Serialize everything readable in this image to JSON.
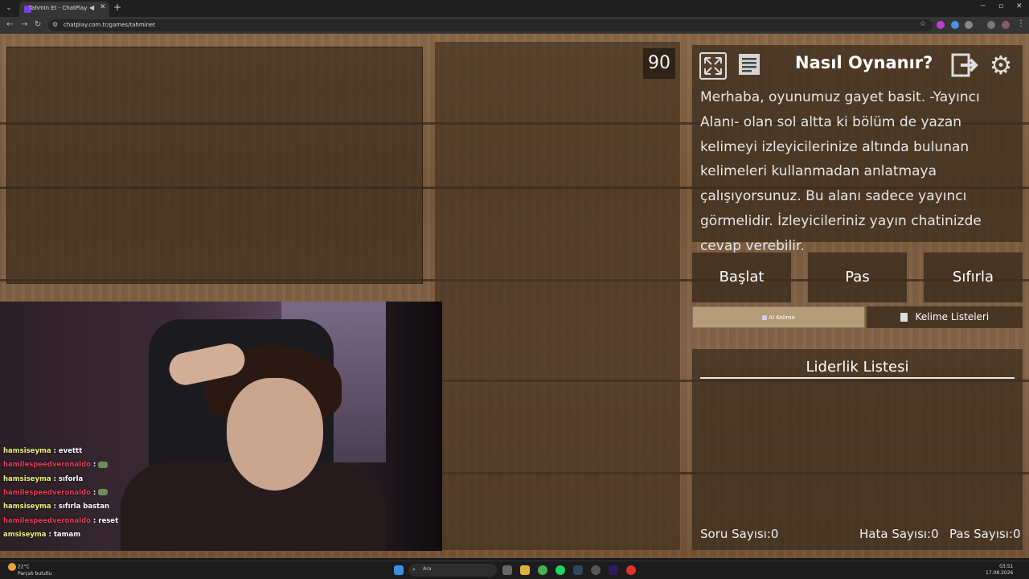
{
  "browser": {
    "tab_title": "Tahmin Et - ChatPlay",
    "url": "chatplay.com.tr/games/tahminet"
  },
  "game": {
    "timer": "90",
    "howto_title": "Nasıl Oynanır?",
    "howto_text": "Merhaba, oyunumuz gayet basit. -Yayıncı Alanı- olan sol altta ki bölüm de yazan kelimeyi izleyicilerinize altında bulunan kelimeleri kullanmadan anlatmaya çalışıyorsunuz. Bu alanı sadece yayıncı görmelidir. İzleyicileriniz yayın chatinizde cevap verebilir.",
    "start_label": "Başlat",
    "pass_label": "Pas",
    "reset_label": "Sıfırla",
    "ai_word_label": "AI Kelime",
    "word_lists_label": "Kelime Listeleri",
    "leaderboard_title": "Liderlik Listesi",
    "stats": {
      "question_count": "Soru Sayısı:0",
      "error_count": "Hata Sayısı:0",
      "pass_count": "Pas Sayısı:0"
    },
    "icons": {
      "fullscreen": "expand-icon",
      "notes": "document-icon",
      "exit": "exit-icon",
      "settings": "gear-icon"
    }
  },
  "chat": [
    {
      "user": "hamsiseyma",
      "msg": " : evettt",
      "color": "#e9f57a",
      "emote": false
    },
    {
      "user": "hamilespeedveronaldo",
      "msg": " :",
      "color": "#e33a55",
      "emote": true
    },
    {
      "user": "hamsiseyma",
      "msg": " : sıforla",
      "color": "#e9f57a",
      "emote": false
    },
    {
      "user": "hamilespeedveronaldo",
      "msg": " :",
      "color": "#e33a55",
      "emote": true
    },
    {
      "user": "hamsiseyma",
      "msg": " : sıfırla bastan",
      "color": "#e9f57a",
      "emote": false
    },
    {
      "user": "hamilespeedveronaldo",
      "msg": " : reset",
      "color": "#e33a55",
      "emote": false
    },
    {
      "user": "amsiseyma",
      "msg": " : tamam",
      "color": "#e9f57a",
      "emote": false
    }
  ],
  "taskbar": {
    "weather_temp": "22°C",
    "weather_desc": "Parçalı bulutlu",
    "search_placeholder": "Ara",
    "time": "03:51",
    "date": "17.08.2026"
  }
}
